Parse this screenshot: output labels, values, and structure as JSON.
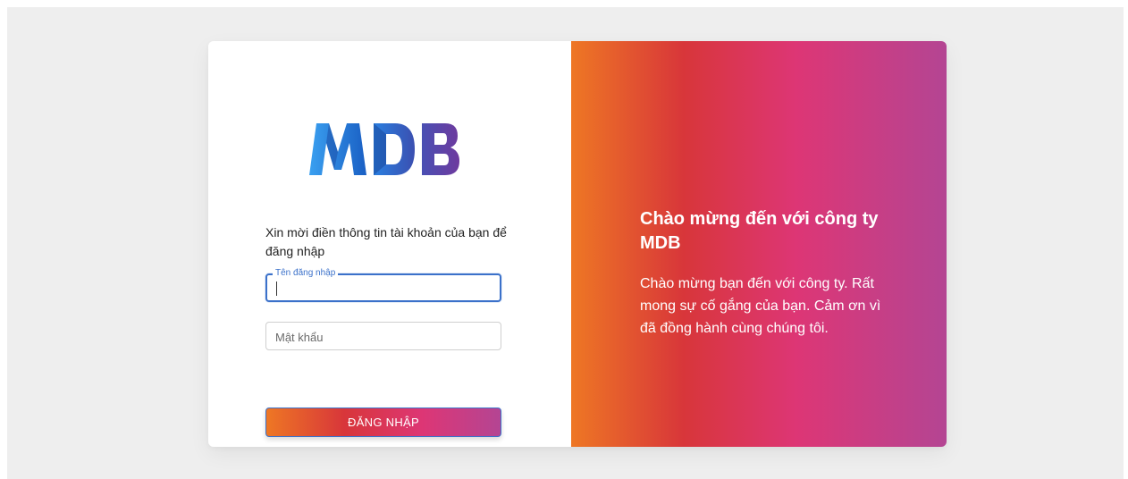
{
  "logo": {
    "text": "MDB",
    "colors": [
      "#1f78d1",
      "#2e5bb8",
      "#6a3fa0"
    ]
  },
  "login": {
    "prompt": "Xin mời điền thông tin tài khoản của bạn để đăng nhập",
    "username_label": "Tên đăng nhập",
    "username_value": "",
    "password_placeholder": "Mật khẩu",
    "submit_label": "ĐĂNG NHẬP"
  },
  "welcome": {
    "title": "Chào mừng đến với công ty MDB",
    "body": "Chào mừng bạn đến với công ty. Rất mong sự cố gắng của bạn. Cảm ơn vì đã đồng hành cùng chúng tôi."
  },
  "colors": {
    "gradient": [
      "#ee7724",
      "#d8363a",
      "#dd3675",
      "#b44593"
    ],
    "focus": "#3b71ca",
    "background": "#eeeeee"
  }
}
